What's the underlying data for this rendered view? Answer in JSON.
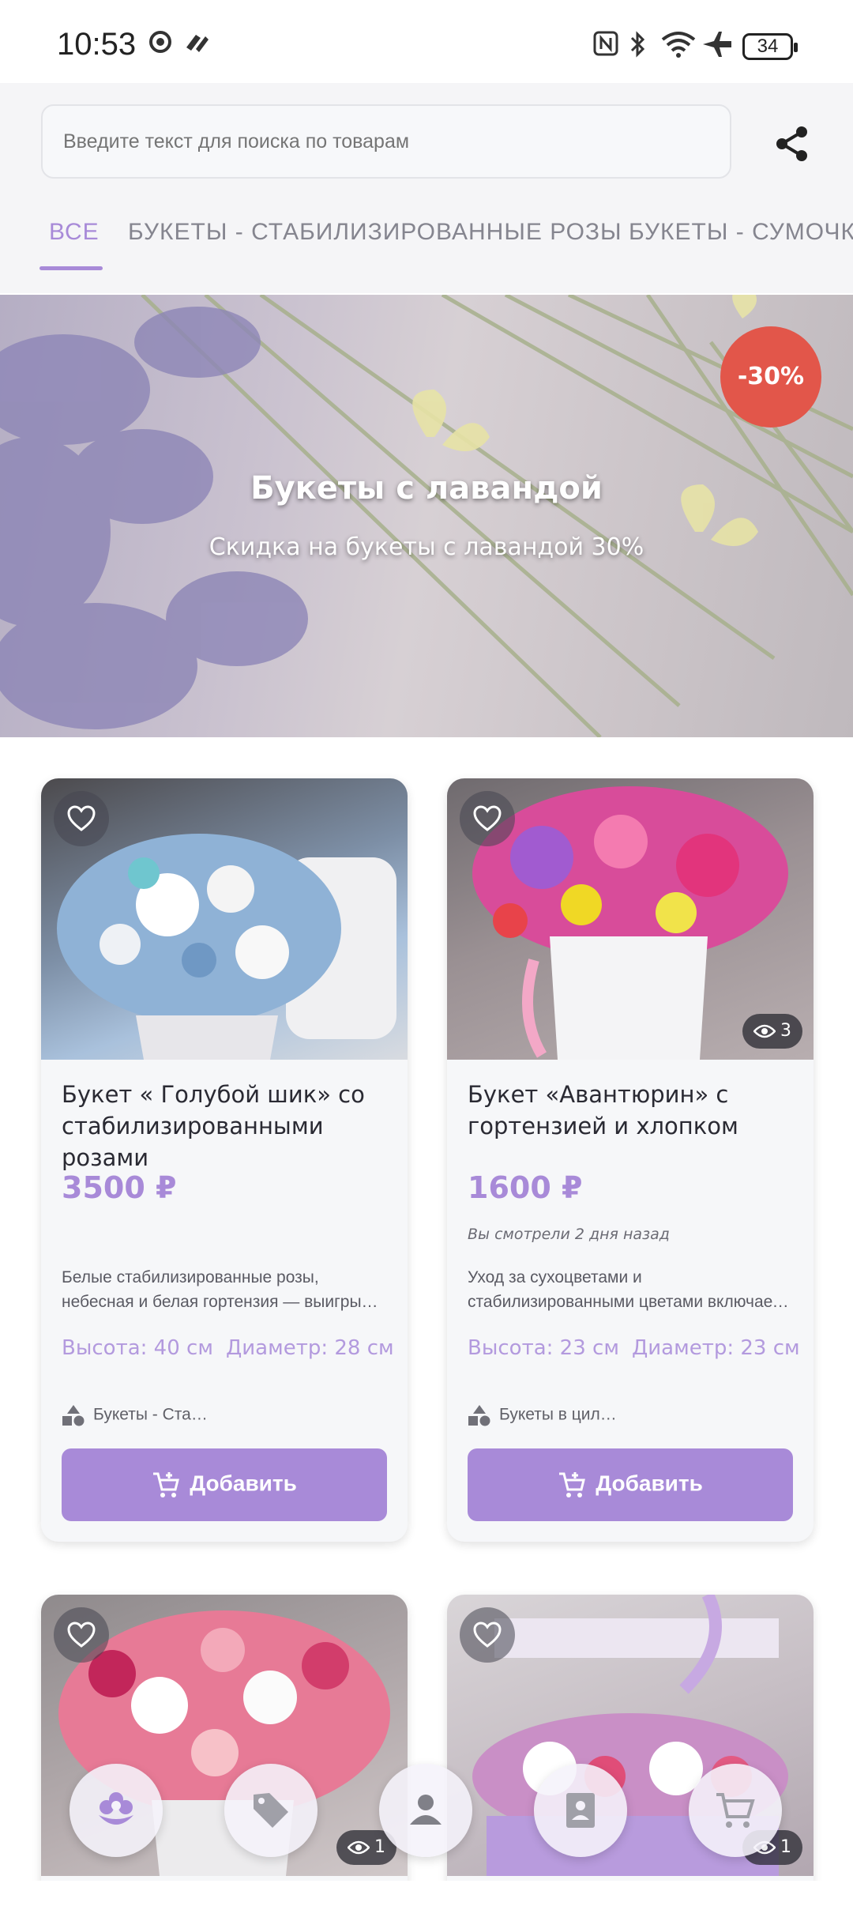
{
  "status_bar": {
    "time": "10:53",
    "battery": "34"
  },
  "search": {
    "placeholder": "Введите текст для поиска по товарам"
  },
  "tabs": [
    {
      "label": "ВСЕ"
    },
    {
      "label": "БУКЕТЫ - СТАБИЛИЗИРОВАННЫЕ РОЗЫ"
    },
    {
      "label": "БУКЕТЫ - СУМОЧКИ"
    }
  ],
  "banner": {
    "title": "Букеты с лавандой",
    "subtitle": "Скидка на букеты с лавандой 30%",
    "badge": "-30%"
  },
  "products": [
    {
      "title_line1": "Букет « Голубой шик» со",
      "title_line2": "стабилизированными розами",
      "price": "3500 ₽",
      "seen": "",
      "desc_line1": "Белые  стабилизированные розы,",
      "desc_line2": "небесная  и белая гортензия — выигры…",
      "height": "Высота: 40 см",
      "diameter": "Диаметр: 28 см",
      "category": "Букеты - Ста…",
      "add_label": "Добавить"
    },
    {
      "title_line1": "Букет «Авантюрин» с",
      "title_line2": "гортензией и хлопком",
      "price": "1600 ₽",
      "seen": "Вы смотрели 2 дня назад",
      "views": "3",
      "desc_line1": " Уход за сухоцветами и",
      "desc_line2": "стабилизированными цветами включает …",
      "height": "Высота: 23 см",
      "diameter": "Диаметр: 23 см",
      "category": "Букеты в цил…",
      "add_label": "Добавить"
    },
    {
      "views": "1"
    },
    {
      "views": "1"
    }
  ],
  "bottom_nav": [
    "flower-icon",
    "tag-icon",
    "profile-icon",
    "contacts-icon",
    "cart-icon"
  ],
  "colors": {
    "accent": "#a88ad8",
    "badge": "#e2564a",
    "background": "#f5f5f7"
  }
}
